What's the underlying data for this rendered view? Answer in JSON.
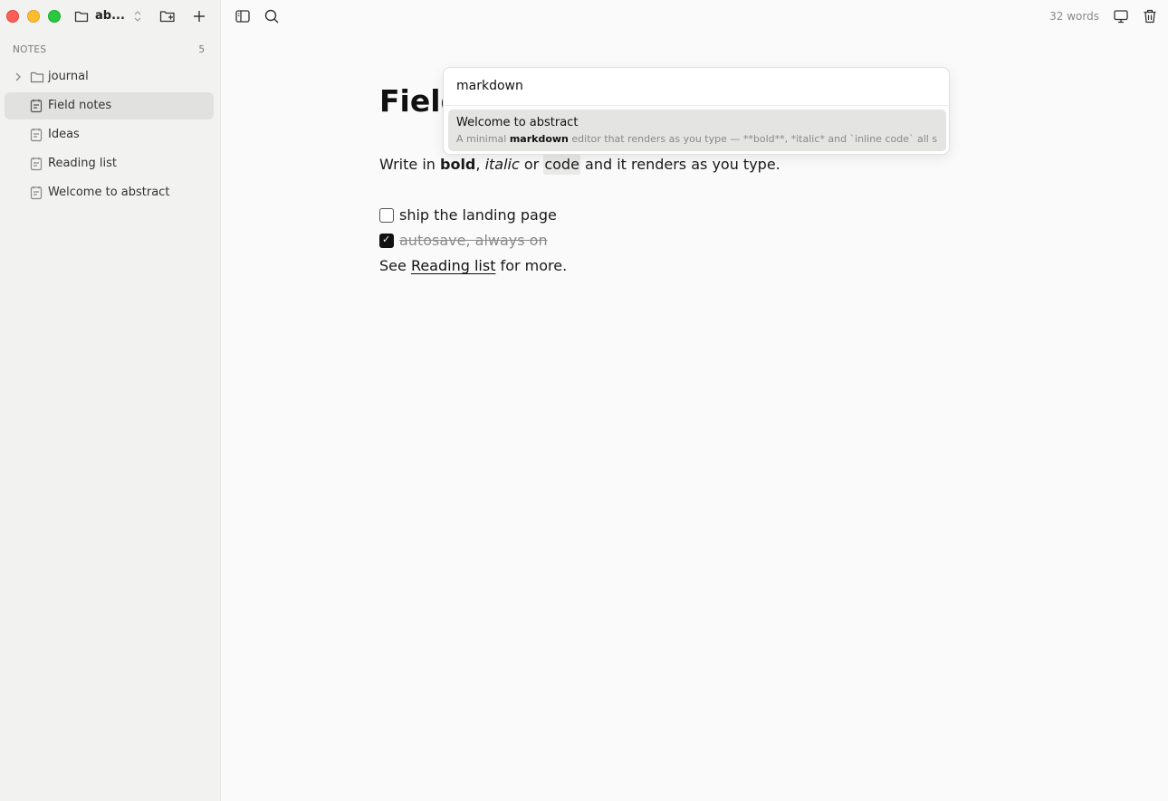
{
  "window": {
    "workspace_name": "ab..."
  },
  "sidebar": {
    "header_label": "NOTES",
    "note_count": "5",
    "items": [
      {
        "label": "journal",
        "type": "folder",
        "active": false
      },
      {
        "label": "Field notes",
        "type": "note",
        "active": true
      },
      {
        "label": "Ideas",
        "type": "note",
        "active": false
      },
      {
        "label": "Reading list",
        "type": "note",
        "active": false
      },
      {
        "label": "Welcome to abstract",
        "type": "note",
        "active": false
      }
    ]
  },
  "toolbar": {
    "word_count": "32 words"
  },
  "editor": {
    "title": "Field notes",
    "para": {
      "t1": "Write in ",
      "bold": "bold",
      "t2": ", ",
      "italic": "italic",
      "t3": " or ",
      "code": "code",
      "t4": " and it renders as you type."
    },
    "tasks": [
      {
        "text": "ship the landing page",
        "checked": false
      },
      {
        "text": "autosave, always on",
        "checked": true
      }
    ],
    "see": {
      "pre": "See ",
      "link": "Reading list",
      "post": " for more."
    }
  },
  "search": {
    "query": "markdown",
    "results": [
      {
        "title": "Welcome to abstract",
        "snippet_pre": "A minimal ",
        "snippet_match": "markdown",
        "snippet_post": " editor that renders as you type — **bold**, *italic* and `inline code` all show up"
      }
    ]
  },
  "colors": {
    "close": "#ff5f57",
    "minimize": "#febc2e",
    "maximize": "#28c840",
    "selection": "#e1e1e0"
  }
}
